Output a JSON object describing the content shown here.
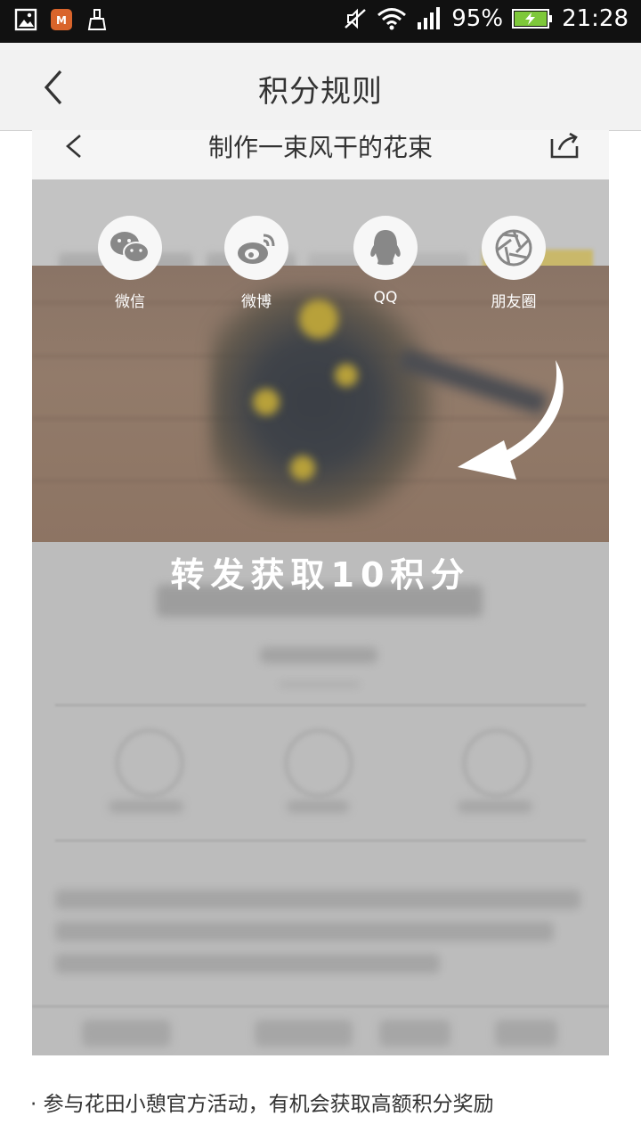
{
  "status_bar": {
    "battery": "95%",
    "time": "21:28",
    "icons": [
      "gallery-icon",
      "app-badge-icon",
      "cleaner-icon",
      "mute-icon",
      "wifi-icon",
      "signal-icon",
      "battery-charging-icon"
    ]
  },
  "app_bar": {
    "title": "积分规则",
    "back_icon": "back-chevron-icon"
  },
  "screenshot": {
    "header_title": "制作一束风干的花束",
    "share_targets": [
      {
        "label": "微信",
        "icon": "wechat-icon"
      },
      {
        "label": "微博",
        "icon": "weibo-icon"
      },
      {
        "label": "QQ",
        "icon": "qq-icon"
      },
      {
        "label": "朋友圈",
        "icon": "moments-icon"
      }
    ],
    "promo_text": "转发获取10积分"
  },
  "rule_text": "参与花田小憩官方活动，有机会获取高额积分奖励",
  "colors": {
    "status_bar": "#111111",
    "app_bar": "#f2f2f2",
    "overlay_grey": "#bcbcbc",
    "battery_green": "#7ec83a"
  }
}
